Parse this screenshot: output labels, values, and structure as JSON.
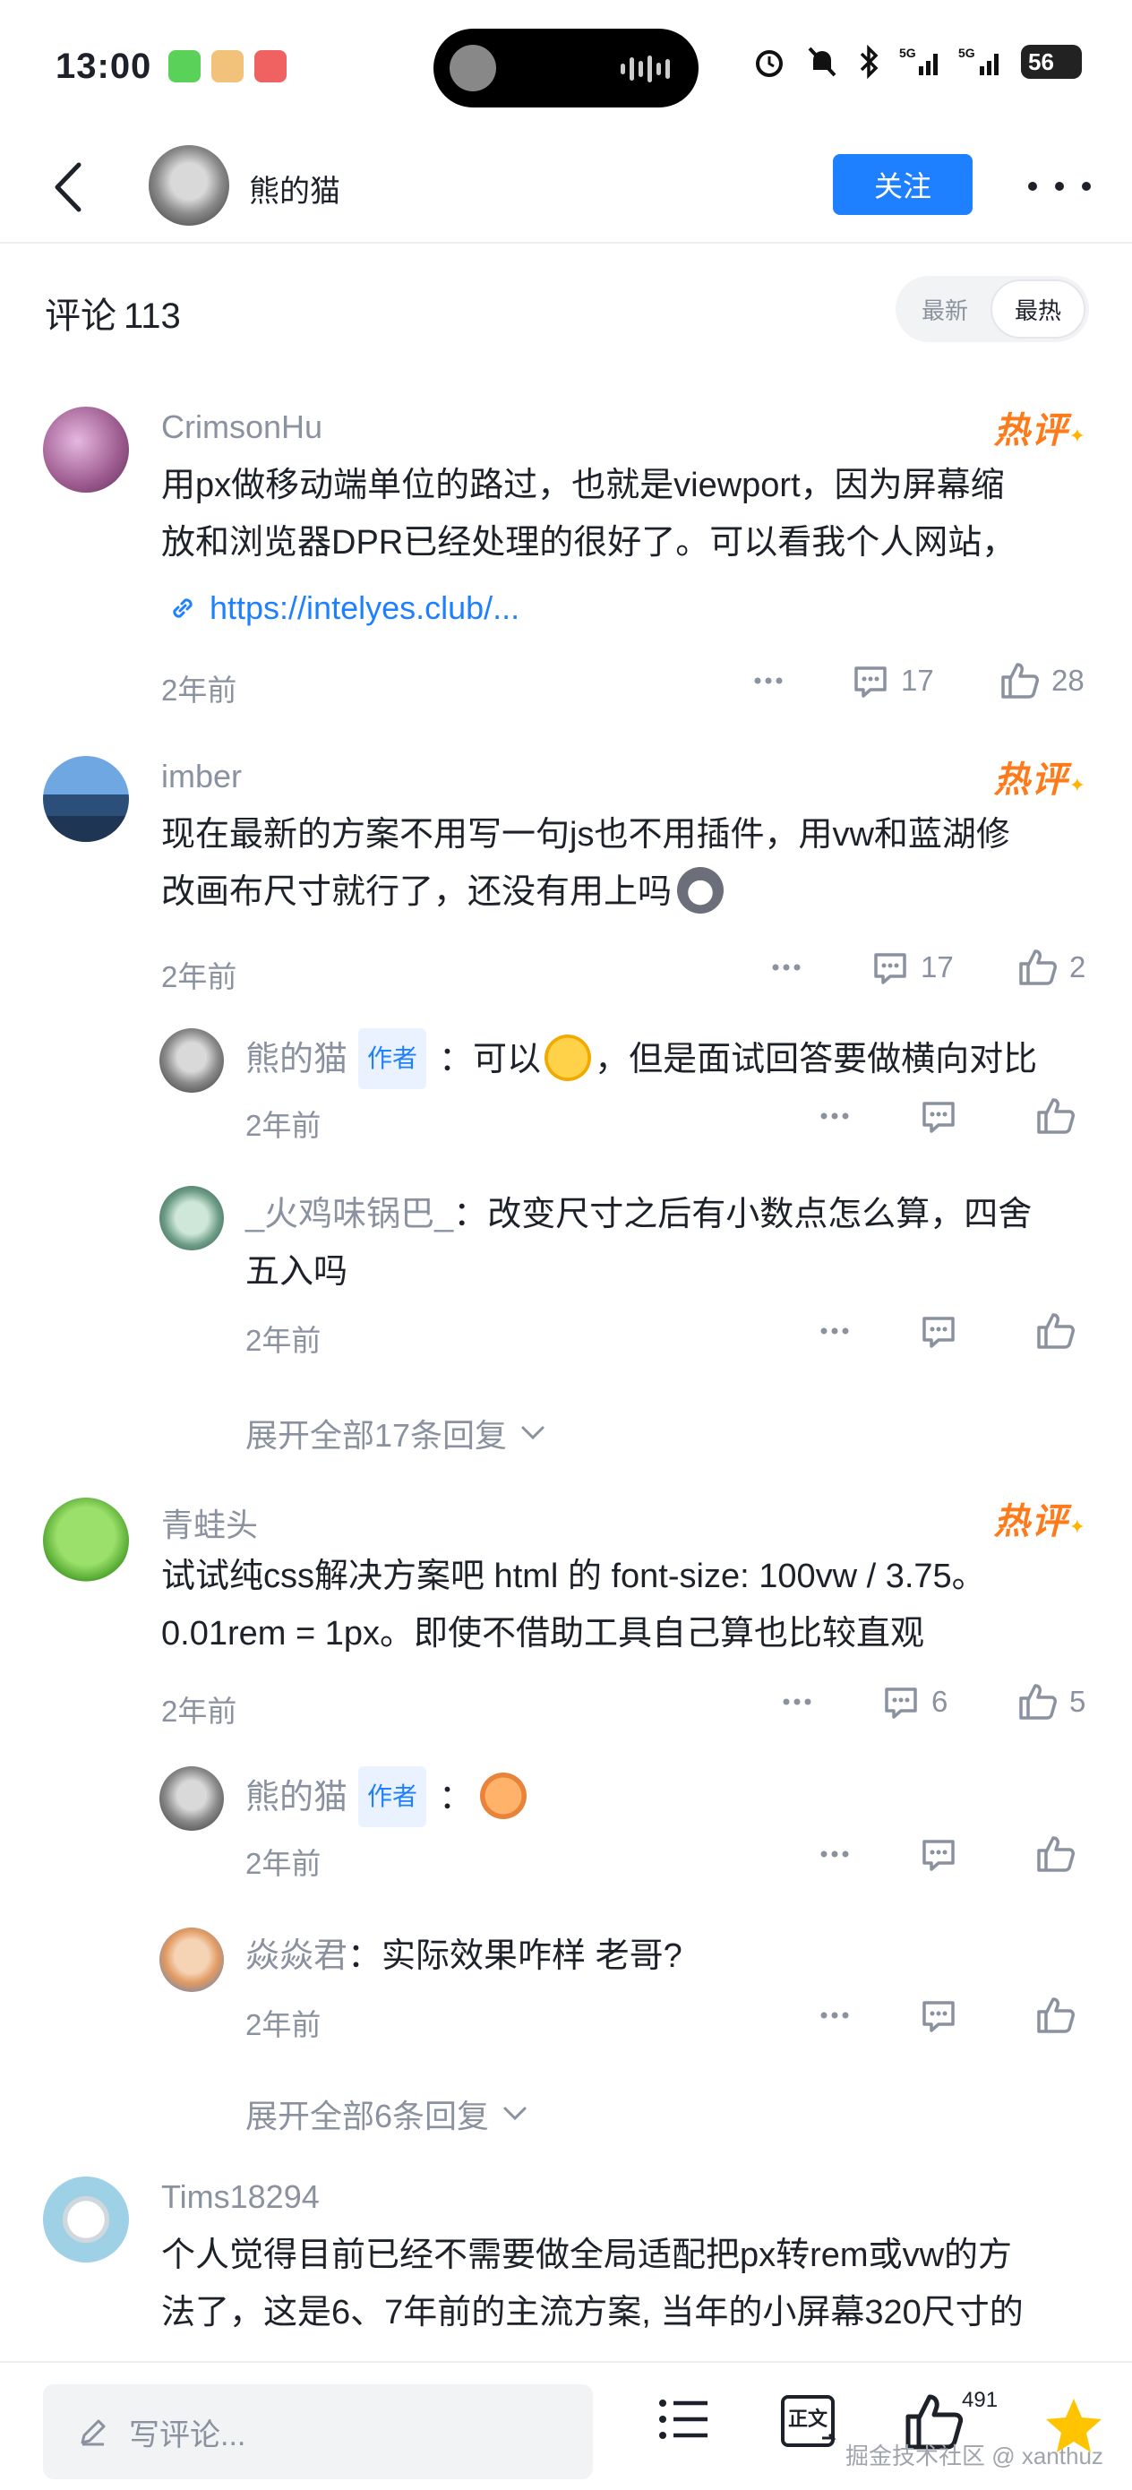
{
  "status_bar": {
    "time": "13:00",
    "battery": "56"
  },
  "nav": {
    "author_name": "熊的猫",
    "follow_label": "关注"
  },
  "comments_header": {
    "title": "评论",
    "count": "113",
    "sort_options": [
      "最新",
      "最热"
    ],
    "active_sort": "最热"
  },
  "hot_badge": "热评",
  "comments": [
    {
      "user": "CrimsonHu",
      "text_lines": [
        "用px做移动端单位的路过，也就是viewport，因为屏幕缩",
        "放和浏览器DPR已经处理的很好了。可以看我个人网站，"
      ],
      "link": "https://intelyes.club/...",
      "time": "2年前",
      "reply_count": "17",
      "like_count": "28"
    },
    {
      "user": "imber",
      "text_lines": [
        "现在最新的方案不用写一句js也不用插件，用vw和蓝湖修",
        "改画布尺寸就行了，还没有用上吗"
      ],
      "time": "2年前",
      "reply_count": "17",
      "like_count": "2",
      "replies": [
        {
          "user": "熊的猫",
          "tag": "作者",
          "text": "可以",
          "text2": "，但是面试回答要做横向对比",
          "time": "2年前"
        },
        {
          "user": "_火鸡味锅巴_",
          "text_lines": [
            "改变尺寸之后有小数点怎么算，四舍",
            "五入吗"
          ],
          "time": "2年前"
        }
      ],
      "expand": "展开全部17条回复"
    },
    {
      "user": "青蛙头",
      "text_lines": [
        "试试纯css解决方案吧 html 的 font-size: 100vw / 3.75。",
        "0.01rem = 1px。即使不借助工具自己算也比较直观"
      ],
      "time": "2年前",
      "reply_count": "6",
      "like_count": "5",
      "replies": [
        {
          "user": "熊的猫",
          "tag": "作者",
          "time": "2年前"
        },
        {
          "user": "焱焱君",
          "text": "实际效果咋样 老哥?",
          "time": "2年前"
        }
      ],
      "expand": "展开全部6条回复"
    },
    {
      "user": "Tims18294",
      "text_lines": [
        "个人觉得目前已经不需要做全局适配把px转rem或vw的方",
        "法了，这是6、7年前的主流方案, 当年的小屏幕320尺寸的"
      ]
    }
  ],
  "bottom_bar": {
    "placeholder": "写评论...",
    "like_count": "491",
    "watermark": "掘金技术社区 @ xanthuz",
    "text_mode_label": "正文"
  },
  "colors": {
    "accent": "#1e80ff",
    "hot": "#ff7a1a",
    "muted": "#8a919f",
    "text": "#1d2129"
  }
}
